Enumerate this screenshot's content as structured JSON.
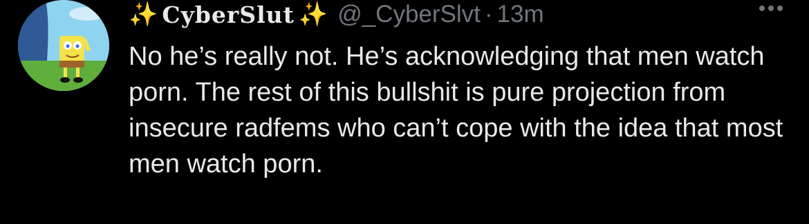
{
  "tweet": {
    "display_name": "CyberSlut",
    "sparkle_left": "✨",
    "sparkle_right": "✨",
    "handle": "@_CyberSlvt",
    "separator": "·",
    "timestamp": "13m",
    "text": "No he’s really not. He’s acknowledging that men watch porn. The rest of this bullshit is pure projection from insecure radfems who can’t cope with the idea that most men watch porn."
  },
  "icons": {
    "avatar": "spongebob-avatar",
    "more": "more-options-icon"
  }
}
